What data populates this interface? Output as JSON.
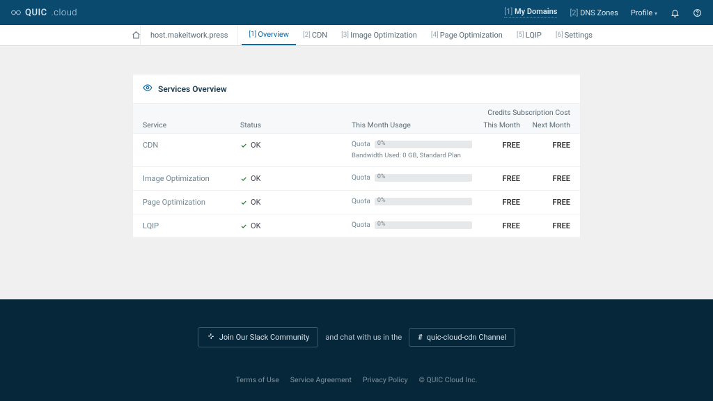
{
  "brand": {
    "name": "QUIC",
    "suffix": ".cloud"
  },
  "topnav": {
    "my_domains_idx": "[1]",
    "my_domains": "My Domains",
    "dns_zones_idx": "[2]",
    "dns_zones": "DNS Zones",
    "profile": "Profile"
  },
  "breadcrumb": "host.makeitwork.press",
  "tabs": [
    {
      "idx": "[1]",
      "label": "Overview",
      "active": true
    },
    {
      "idx": "[2]",
      "label": "CDN"
    },
    {
      "idx": "[3]",
      "label": "Image Optimization"
    },
    {
      "idx": "[4]",
      "label": "Page Optimization"
    },
    {
      "idx": "[5]",
      "label": "LQIP"
    },
    {
      "idx": "[6]",
      "label": "Settings"
    }
  ],
  "panel": {
    "title": "Services Overview",
    "super_header": "Credits Subscription Cost",
    "cols": {
      "service": "Service",
      "status": "Status",
      "usage": "This Month Usage",
      "this_month": "This Month",
      "next_month": "Next Month"
    }
  },
  "quota_label": "Quota",
  "rows": [
    {
      "service": "CDN",
      "status": "OK",
      "pct": "0%",
      "note": "Bandwidth Used: 0 GB,   Standard Plan",
      "this_month": "FREE",
      "next_month": "FREE"
    },
    {
      "service": "Image Optimization",
      "status": "OK",
      "pct": "0%",
      "this_month": "FREE",
      "next_month": "FREE"
    },
    {
      "service": "Page Optimization",
      "status": "OK",
      "pct": "0%",
      "this_month": "FREE",
      "next_month": "FREE"
    },
    {
      "service": "LQIP",
      "status": "OK",
      "pct": "0%",
      "this_month": "FREE",
      "next_month": "FREE"
    }
  ],
  "footer": {
    "slack": "Join Our Slack Community",
    "mid": "and chat with us in the",
    "channel": "quic-cloud-cdn Channel",
    "links": {
      "terms": "Terms of Use",
      "service": "Service Agreement",
      "privacy": "Privacy Policy",
      "copyright": "© QUIC Cloud Inc."
    }
  }
}
